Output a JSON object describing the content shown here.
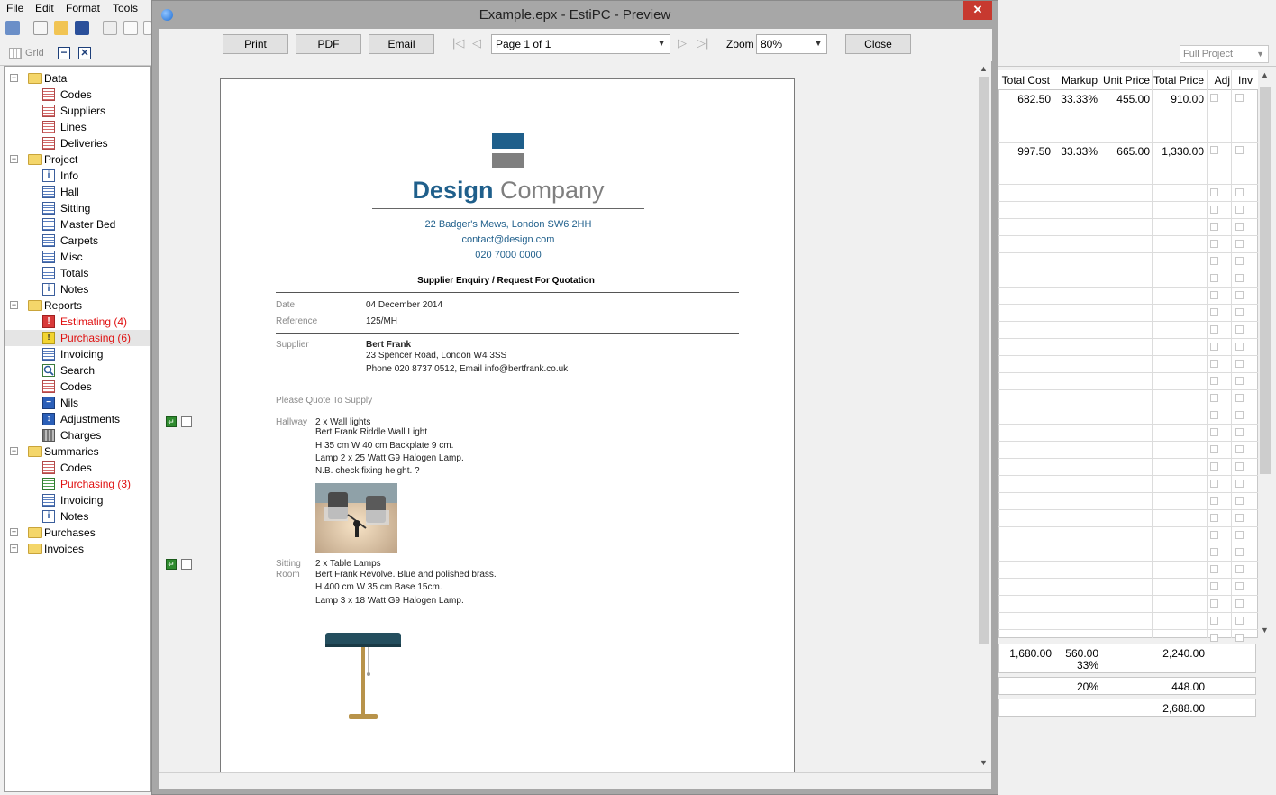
{
  "menubar": {
    "file": "File",
    "edit": "Edit",
    "format": "Format",
    "tools": "Tools"
  },
  "gridbar": {
    "grid_label": "Grid"
  },
  "tree": {
    "data": {
      "label": "Data",
      "items": [
        "Codes",
        "Suppliers",
        "Lines",
        "Deliveries"
      ]
    },
    "project": {
      "label": "Project",
      "items": [
        "Info",
        "Hall",
        "Sitting",
        "Master Bed",
        "Carpets",
        "Misc",
        "Totals",
        "Notes"
      ]
    },
    "reports": {
      "label": "Reports",
      "items": [
        "Estimating (4)",
        "Purchasing (6)",
        "Invoicing",
        "Search",
        "Codes",
        "Nils",
        "Adjustments",
        "Charges"
      ]
    },
    "summaries": {
      "label": "Summaries",
      "items": [
        "Codes",
        "Purchasing (3)",
        "Invoicing",
        "Notes"
      ]
    },
    "purchases": {
      "label": "Purchases"
    },
    "invoices": {
      "label": "Invoices"
    }
  },
  "grid": {
    "scope_select": "Full Project",
    "headers": {
      "total_cost": "Total Cost",
      "markup": "Markup",
      "unit_price": "Unit Price",
      "total_price": "Total Price",
      "adj": "Adj",
      "inv": "Inv"
    },
    "rows": [
      {
        "total_cost": "682.50",
        "markup": "33.33%",
        "unit_price": "455.00",
        "total_price": "910.00"
      },
      {
        "total_cost": "997.50",
        "markup": "33.33%",
        "unit_price": "665.00",
        "total_price": "1,330.00"
      }
    ],
    "totals": {
      "cost": "1,680.00",
      "markup": "560.00",
      "markup_pct": "33%",
      "price": "2,240.00",
      "vat_pct": "20%",
      "vat": "448.00",
      "grand": "2,688.00"
    }
  },
  "preview": {
    "title": "Example.epx - EstiPC - Preview",
    "print": "Print",
    "pdf": "PDF",
    "email": "Email",
    "page_select": "Page 1 of 1",
    "zoom_label": "Zoom",
    "zoom_value": "80%",
    "close": "Close"
  },
  "doc": {
    "company_bold": "Design",
    "company_light": "Company",
    "address": "22 Badger's Mews, London SW6 2HH",
    "email": "contact@design.com",
    "phone": "020 7000 0000",
    "heading": "Supplier Enquiry / Request For Quotation",
    "date_label": "Date",
    "date_value": "04 December 2014",
    "ref_label": "Reference",
    "ref_value": "125/MH",
    "supplier_label": "Supplier",
    "supplier_name": "Bert Frank",
    "supplier_addr": "23 Spencer Road, London W4 3SS",
    "supplier_contact": "Phone 020 8737 0512, Email info@bertfrank.co.uk",
    "please_quote": "Please Quote To Supply",
    "item1": {
      "room": "Hallway",
      "lines": [
        "2 x Wall lights",
        "Bert Frank Riddle Wall Light",
        "H 35 cm  W 40 cm  Backplate 9 cm.",
        "Lamp 2 x 25 Watt G9 Halogen Lamp.",
        "N.B. check fixing height. ?"
      ]
    },
    "item2": {
      "room1": "Sitting",
      "room2": "Room",
      "lines": [
        "2 x Table Lamps",
        "Bert Frank Revolve. Blue and polished brass.",
        "H 400 cm  W 35 cm  Base 15cm.",
        "Lamp 3 x 18 Watt G9 Halogen Lamp."
      ]
    }
  },
  "colors": {
    "brand_blue": "#1f5f8b",
    "brand_gray": "#7f7f7f",
    "close_red": "#c7392f"
  }
}
